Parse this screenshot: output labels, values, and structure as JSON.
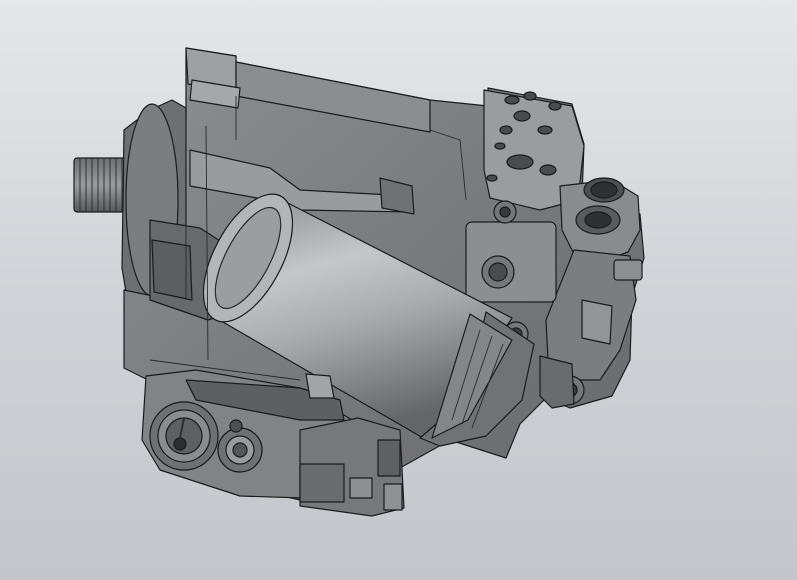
{
  "scene": {
    "subject": "hydraulic-pump-cad-model",
    "colors": {
      "background_top": "#e6e7ea",
      "background_bottom": "#c4c6cb",
      "body": "#7a7b7e",
      "body_light": "#98999c",
      "body_dark": "#55565a",
      "edge": "#1b1b1d",
      "cylinder_light": "#c2c3c6",
      "cylinder_dark": "#6b6c70"
    }
  }
}
